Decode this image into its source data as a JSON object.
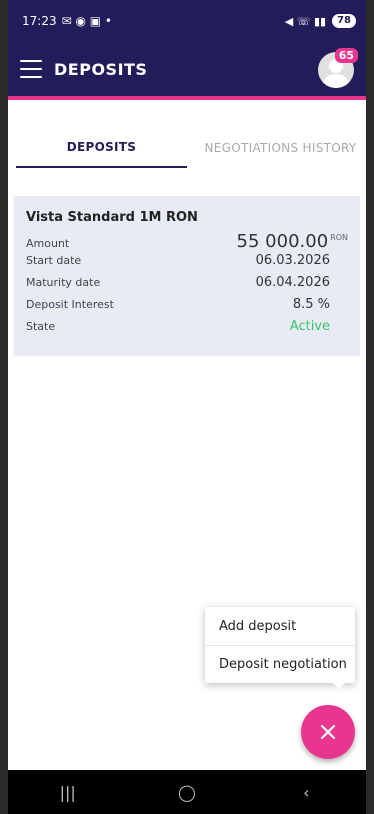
{
  "status_bar": {
    "time": "17:23",
    "battery": "78"
  },
  "app_bar": {
    "title": "DEPOSITS",
    "notification_count": "65"
  },
  "tabs": [
    {
      "label": "DEPOSITS",
      "active": true
    },
    {
      "label": "NEGOTIATIONS HISTORY",
      "active": false
    }
  ],
  "deposit": {
    "name": "Vista Standard 1M RON",
    "rows": {
      "amount": {
        "label": "Amount",
        "value": "55 000.00",
        "unit": "RON"
      },
      "start_date": {
        "label": "Start date",
        "value": "06.03.2026"
      },
      "maturity_date": {
        "label": "Maturity date",
        "value": "06.04.2026"
      },
      "interest": {
        "label": "Deposit Interest",
        "value": "8.5 %"
      },
      "state": {
        "label": "State",
        "value": "Active"
      }
    }
  },
  "popup_menu": {
    "add_deposit": "Add deposit",
    "deposit_negotiation": "Deposit negotiation"
  },
  "colors": {
    "primary": "#231c5a",
    "accent": "#e8368f",
    "active_state": "#3cc46b",
    "card_bg": "#e8ebf5"
  },
  "icons": [
    "menu-icon",
    "avatar-icon",
    "close-icon",
    "recents-icon",
    "home-icon",
    "back-icon"
  ]
}
